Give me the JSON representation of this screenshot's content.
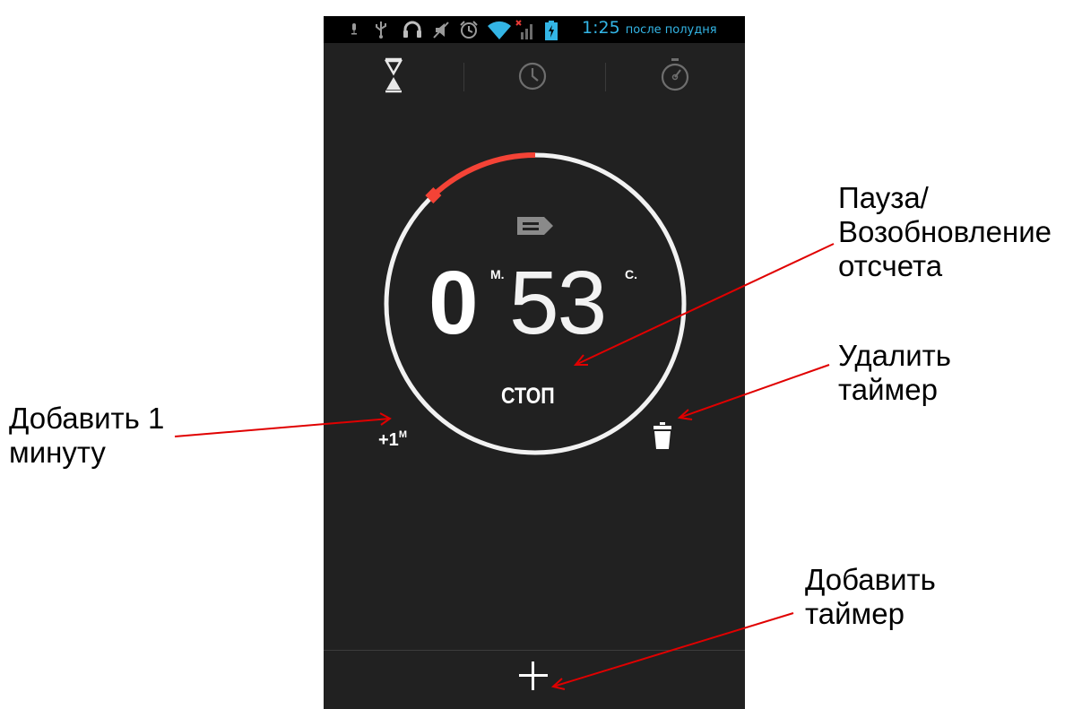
{
  "status_bar": {
    "time": "1:25",
    "ampm": "после полудня",
    "icons": [
      "mic-icon",
      "usb-icon",
      "headphones-icon",
      "mute-icon",
      "alarm-icon",
      "wifi-icon",
      "signal-icon",
      "battery-icon"
    ],
    "accent_color": "#33b5e5"
  },
  "tabs": [
    {
      "name": "timer",
      "icon": "hourglass-icon",
      "active": true
    },
    {
      "name": "clock",
      "icon": "clock-icon",
      "active": false
    },
    {
      "name": "stopwatch",
      "icon": "stopwatch-icon",
      "active": false
    }
  ],
  "timer": {
    "minutes": "0",
    "minutes_unit": "М.",
    "seconds": "53",
    "seconds_unit": "С.",
    "stop_label": "СТОП",
    "add_minute_label": "+1",
    "add_minute_unit": "М",
    "elapsed_fraction": 0.12,
    "progress_color": "#f44336"
  },
  "annotations": {
    "pause_resume": "Пауза/\nВозобновление\nотсчета",
    "delete_timer": "Удалить\nтаймер",
    "add_one_minute": "Добавить 1\nминуту",
    "add_timer": "Добавить\nтаймер",
    "arrow_color": "#e00000"
  }
}
